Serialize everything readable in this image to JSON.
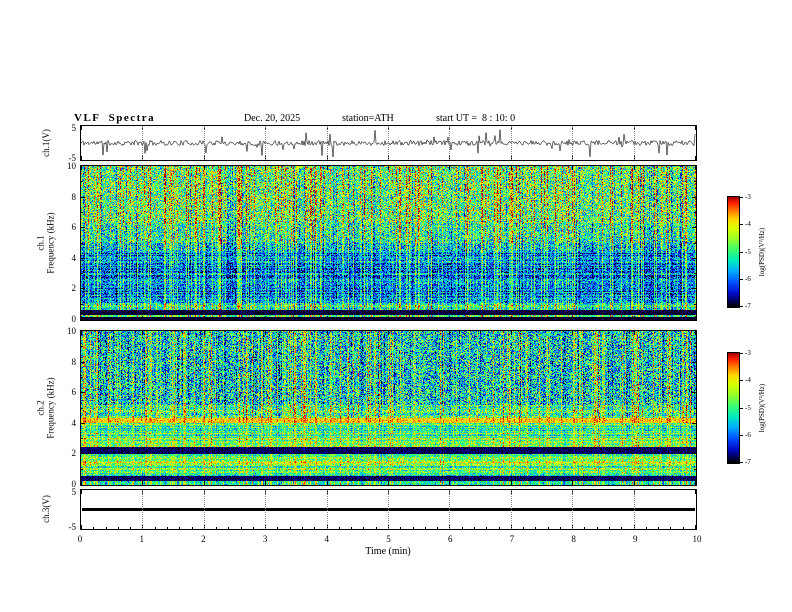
{
  "header": {
    "title": "VLF  Spectra",
    "date": "Dec. 20, 2025",
    "station": "station=ATH",
    "start_ut": "start UT =  8 : 10: 0"
  },
  "x_axis": {
    "label": "Time  (min)",
    "min": 0,
    "max": 10,
    "ticks": [
      "0",
      "1",
      "2",
      "3",
      "4",
      "5",
      "6",
      "7",
      "8",
      "9",
      "10"
    ]
  },
  "panel_labels": {
    "p1": {
      "line1": "ch.1(V)",
      "ymax": "5",
      "ymin": "-5"
    },
    "p2": {
      "line1": "ch.1",
      "line2": "Frequency (kHz)",
      "yticks": [
        "0",
        "2",
        "4",
        "6",
        "8",
        "10"
      ]
    },
    "p3": {
      "line1": "ch.2",
      "line2": "Frequency (kHz)",
      "yticks": [
        "0",
        "2",
        "4",
        "6",
        "8",
        "10"
      ]
    },
    "p4": {
      "line1": "ch.3(V)",
      "ymax": "5",
      "ymin": "-5"
    }
  },
  "colorbar_label": "log(PSD)(V²/Hz)",
  "colorbar_ticks": [
    "-3",
    "-4",
    "-5",
    "-6",
    "-7"
  ],
  "colormap": [
    [
      0.0,
      [
        0,
        0,
        0
      ]
    ],
    [
      0.05,
      [
        0,
        0,
        90
      ]
    ],
    [
      0.12,
      [
        0,
        10,
        200
      ]
    ],
    [
      0.22,
      [
        0,
        80,
        255
      ]
    ],
    [
      0.32,
      [
        0,
        170,
        255
      ]
    ],
    [
      0.42,
      [
        0,
        235,
        190
      ]
    ],
    [
      0.52,
      [
        60,
        255,
        110
      ]
    ],
    [
      0.62,
      [
        150,
        255,
        40
      ]
    ],
    [
      0.72,
      [
        220,
        255,
        0
      ]
    ],
    [
      0.8,
      [
        255,
        215,
        0
      ]
    ],
    [
      0.88,
      [
        255,
        120,
        0
      ]
    ],
    [
      0.95,
      [
        255,
        30,
        0
      ]
    ],
    [
      1.0,
      [
        165,
        0,
        0
      ]
    ]
  ],
  "chart_data": [
    {
      "id": "p1",
      "type": "line",
      "name": "ch.1 time series",
      "ylabel": "ch.1(V)",
      "xlabel": "Time (min)",
      "xlim": [
        0,
        10
      ],
      "ylim": [
        -5,
        5
      ],
      "description": "Noisy VLF channel-1 voltage ~±1 V with frequent impulsive spikes to ±4 V",
      "seed": 11,
      "noise_amplitude": 0.75,
      "spike_probability": 0.055,
      "spike_min": 1.2,
      "spike_max": 3.8,
      "line_color": "#000000"
    },
    {
      "id": "p2",
      "type": "heatmap",
      "name": "ch.1 spectrogram",
      "ylabel": "ch.1 Frequency (kHz)",
      "xlabel": "Time (min)",
      "xlim": [
        0,
        10
      ],
      "fmax": 10,
      "value_label": "log(PSD)(V²/Hz)",
      "value_range": [
        -7,
        -3
      ],
      "seed": 23,
      "impulse_probability": 0.3,
      "impulse_strength": 0.42,
      "dip_probability": 0.1,
      "dip_strength": 0.15,
      "bands": [
        {
          "f": [
            6.3,
            10.0
          ],
          "base": 0.52,
          "var": 0.3
        },
        {
          "f": [
            5.0,
            6.3
          ],
          "base": 0.44,
          "var": 0.26
        },
        {
          "f": [
            4.5,
            5.0
          ],
          "base": 0.34,
          "var": 0.24
        },
        {
          "f": [
            1.05,
            4.5
          ],
          "base": 0.26,
          "var": 0.2,
          "rowvar": 0.1,
          "impulse_scale": 0.75
        },
        {
          "f": [
            0.6,
            1.05
          ],
          "base": 0.46,
          "var": 0.2,
          "rowvar": 0.08
        },
        {
          "f": [
            0.3,
            0.6
          ],
          "base": 0.03,
          "var": 0.03,
          "impulse_scale": 0.05
        },
        {
          "f": [
            0.14,
            0.3
          ],
          "base": 0.5,
          "var": 0.15
        },
        {
          "f": [
            0.0,
            0.14
          ],
          "base": 0.02,
          "var": 0.02,
          "impulse_scale": 0.05
        }
      ]
    },
    {
      "id": "p3",
      "type": "heatmap",
      "name": "ch.2 spectrogram",
      "ylabel": "ch.2 Frequency (kHz)",
      "xlabel": "Time (min)",
      "xlim": [
        0,
        10
      ],
      "fmax": 10,
      "value_label": "log(PSD)(V²/Hz)",
      "value_range": [
        -7,
        -3
      ],
      "seed": 37,
      "impulse_probability": 0.28,
      "impulse_strength": 0.4,
      "dip_probability": 0.12,
      "dip_strength": 0.14,
      "bands": [
        {
          "f": [
            5.2,
            10.0
          ],
          "base": 0.38,
          "var": 0.3
        },
        {
          "f": [
            4.35,
            5.2
          ],
          "base": 0.5,
          "var": 0.24,
          "rowvar": 0.08
        },
        {
          "f": [
            4.05,
            4.35
          ],
          "base": 0.8,
          "var": 0.1,
          "impulse_scale": 0.3
        },
        {
          "f": [
            2.45,
            4.05
          ],
          "base": 0.52,
          "var": 0.18,
          "rowvar": 0.15,
          "impulse_scale": 0.6
        },
        {
          "f": [
            2.0,
            2.45
          ],
          "base": 0.05,
          "var": 0.04,
          "impulse_scale": 0.05
        },
        {
          "f": [
            1.5,
            2.0
          ],
          "base": 0.56,
          "var": 0.18,
          "rowvar": 0.12,
          "impulse_scale": 0.5
        },
        {
          "f": [
            1.4,
            1.5
          ],
          "base": 0.78,
          "var": 0.1,
          "impulse_scale": 0.3
        },
        {
          "f": [
            0.55,
            1.4
          ],
          "base": 0.5,
          "var": 0.18,
          "rowvar": 0.12,
          "impulse_scale": 0.5
        },
        {
          "f": [
            0.25,
            0.55
          ],
          "base": 0.05,
          "var": 0.04,
          "impulse_scale": 0.05
        },
        {
          "f": [
            0.0,
            0.25
          ],
          "base": 0.45,
          "var": 0.15
        }
      ]
    },
    {
      "id": "p4",
      "type": "flat",
      "name": "ch.3 time series",
      "ylabel": "ch.3(V)",
      "xlabel": "Time (min)",
      "xlim": [
        0,
        10
      ],
      "ylim": [
        -5,
        5
      ],
      "value": 0,
      "line_color": "#000000",
      "line_width": 3,
      "description": "Channel 3 is flat at 0 V (thick black line)"
    }
  ]
}
